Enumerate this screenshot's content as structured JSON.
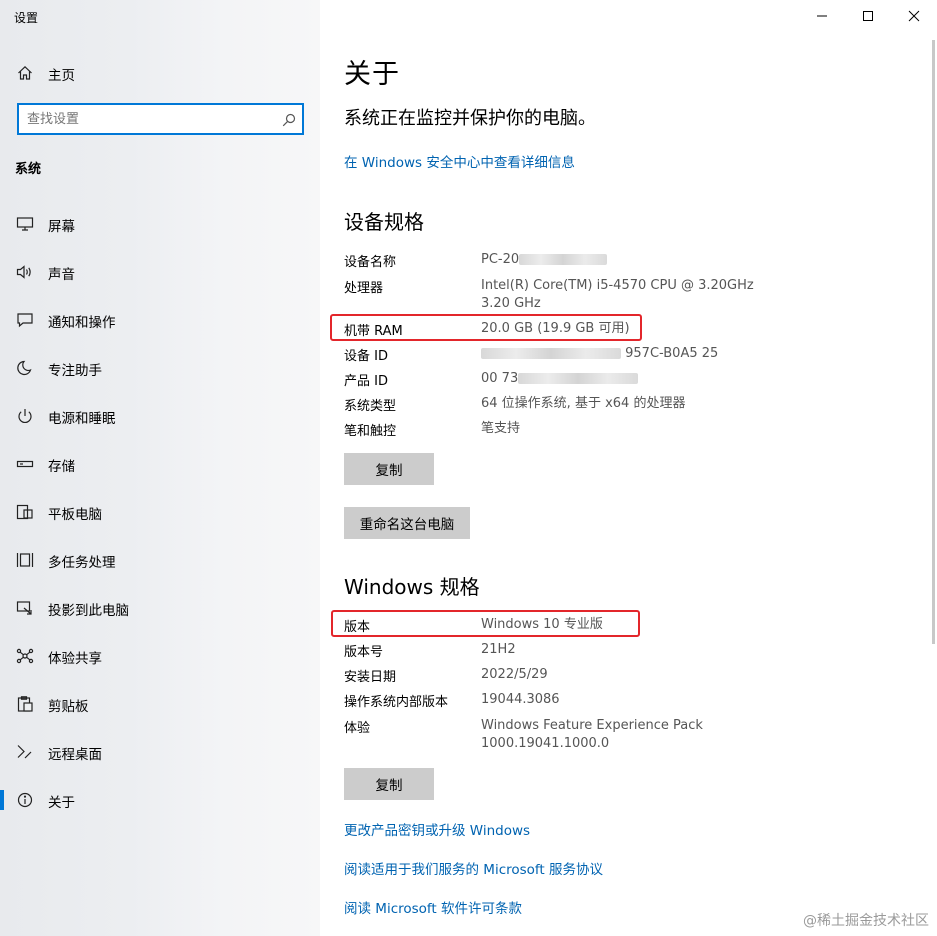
{
  "app_title": "设置",
  "sidebar": {
    "home": "主页",
    "search_placeholder": "查找设置",
    "section": "系统",
    "items": [
      {
        "label": "屏幕",
        "icon": "monitor-icon"
      },
      {
        "label": "声音",
        "icon": "speaker-icon"
      },
      {
        "label": "通知和操作",
        "icon": "notification-icon"
      },
      {
        "label": "专注助手",
        "icon": "moon-icon"
      },
      {
        "label": "电源和睡眠",
        "icon": "power-icon"
      },
      {
        "label": "存储",
        "icon": "storage-icon"
      },
      {
        "label": "平板电脑",
        "icon": "tablet-icon"
      },
      {
        "label": "多任务处理",
        "icon": "multitask-icon"
      },
      {
        "label": "投影到此电脑",
        "icon": "project-icon"
      },
      {
        "label": "体验共享",
        "icon": "share-icon"
      },
      {
        "label": "剪贴板",
        "icon": "clipboard-icon"
      },
      {
        "label": "远程桌面",
        "icon": "remote-icon"
      },
      {
        "label": "关于",
        "icon": "info-icon",
        "active": true
      }
    ]
  },
  "main": {
    "title": "关于",
    "protect_text": "系统正在监控并保护你的电脑。",
    "security_link": "在 Windows 安全中心中查看详细信息",
    "device_section": "设备规格",
    "device_specs": [
      {
        "label": "设备名称",
        "value": "PC-20"
      },
      {
        "label": "处理器",
        "value": "Intel(R) Core(TM) i5-4570 CPU @ 3.20GHz   3.20 GHz"
      },
      {
        "label": "机带 RAM",
        "value": "20.0 GB (19.9 GB 可用)"
      },
      {
        "label": "设备 ID",
        "value": "957C-B0A5  25"
      },
      {
        "label": "产品 ID",
        "value": "00  73"
      },
      {
        "label": "系统类型",
        "value": "64 位操作系统, 基于 x64 的处理器"
      },
      {
        "label": "笔和触控",
        "value": "笔支持"
      }
    ],
    "copy_button": "复制",
    "rename_button": "重命名这台电脑",
    "windows_section": "Windows 规格",
    "windows_specs": [
      {
        "label": "版本",
        "value": "Windows 10 专业版"
      },
      {
        "label": "版本号",
        "value": "21H2"
      },
      {
        "label": "安装日期",
        "value": "2022/5/29"
      },
      {
        "label": "操作系统内部版本",
        "value": "19044.3086"
      },
      {
        "label": "体验",
        "value": "Windows Feature Experience Pack 1000.19041.1000.0"
      }
    ],
    "copy_button_2": "复制",
    "links": [
      "更改产品密钥或升级 Windows",
      "阅读适用于我们服务的 Microsoft 服务协议",
      "阅读 Microsoft 软件许可条款"
    ]
  },
  "watermark": "@稀土掘金技术社区",
  "colors": {
    "accent": "#0078d7",
    "link": "#0063b1",
    "highlight": "#e3262b",
    "button": "#cccccc"
  }
}
